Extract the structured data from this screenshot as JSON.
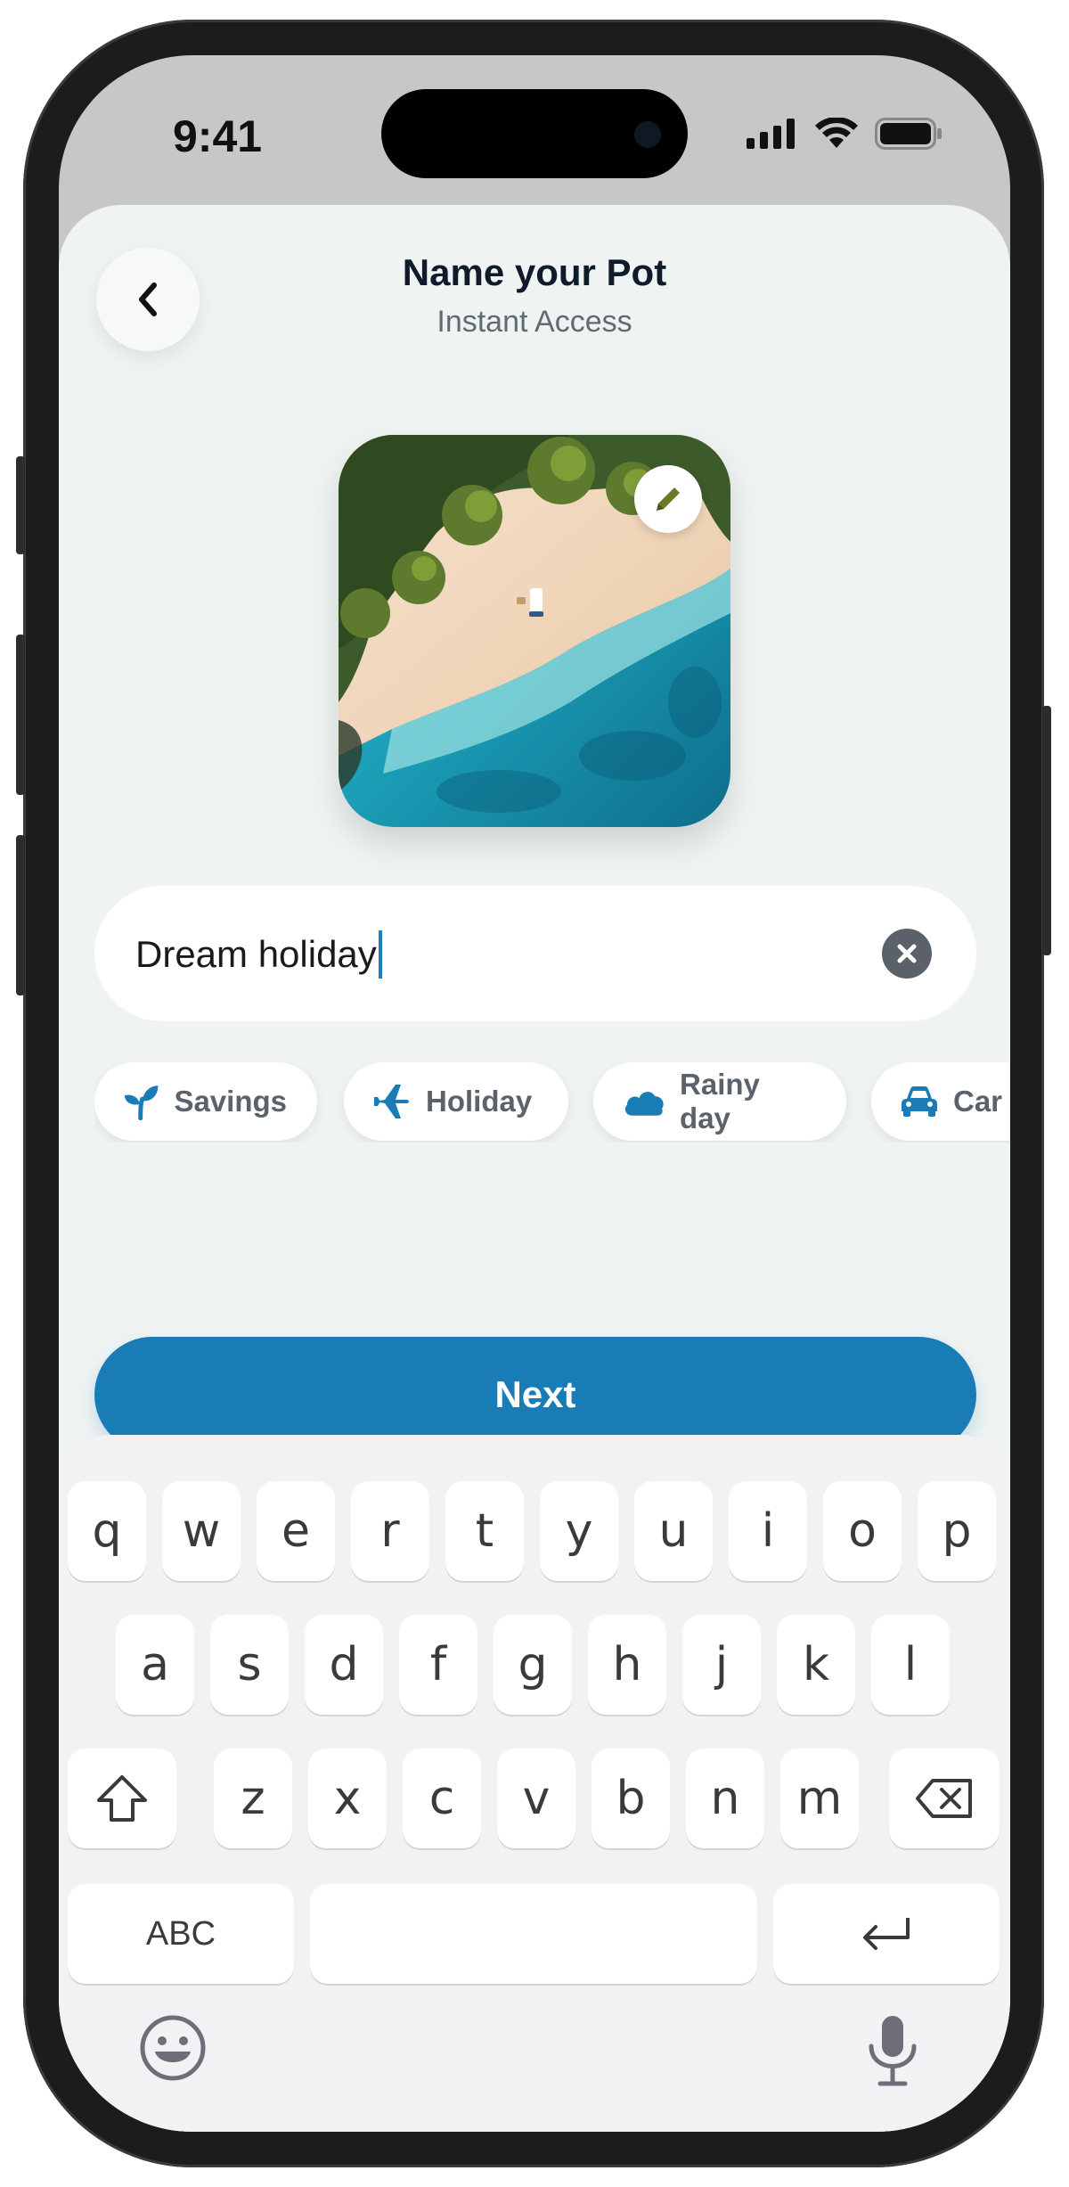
{
  "status_bar": {
    "time": "9:41"
  },
  "header": {
    "title": "Name your Pot",
    "subtitle": "Instant Access"
  },
  "photo": {
    "subject": "aerial beach with palm trees and turquoise sea"
  },
  "name_field": {
    "value": "Dream holiday"
  },
  "chips": [
    {
      "label": "Savings",
      "icon": "sprout-icon"
    },
    {
      "label": "Holiday",
      "icon": "airplane-icon"
    },
    {
      "label": "Rainy day",
      "icon": "cloud-icon"
    },
    {
      "label": "Car",
      "icon": "car-icon"
    }
  ],
  "next_button": {
    "label": "Next"
  },
  "keyboard": {
    "row1": [
      "q",
      "w",
      "e",
      "r",
      "t",
      "y",
      "u",
      "i",
      "o",
      "p"
    ],
    "row2": [
      "a",
      "s",
      "d",
      "f",
      "g",
      "h",
      "j",
      "k",
      "l"
    ],
    "row3": [
      "z",
      "x",
      "c",
      "v",
      "b",
      "n",
      "m"
    ],
    "abc_label": "ABC"
  },
  "colors": {
    "accent": "#1a7cb6",
    "background": "#eff4f3",
    "chip_text": "#5a636b"
  }
}
